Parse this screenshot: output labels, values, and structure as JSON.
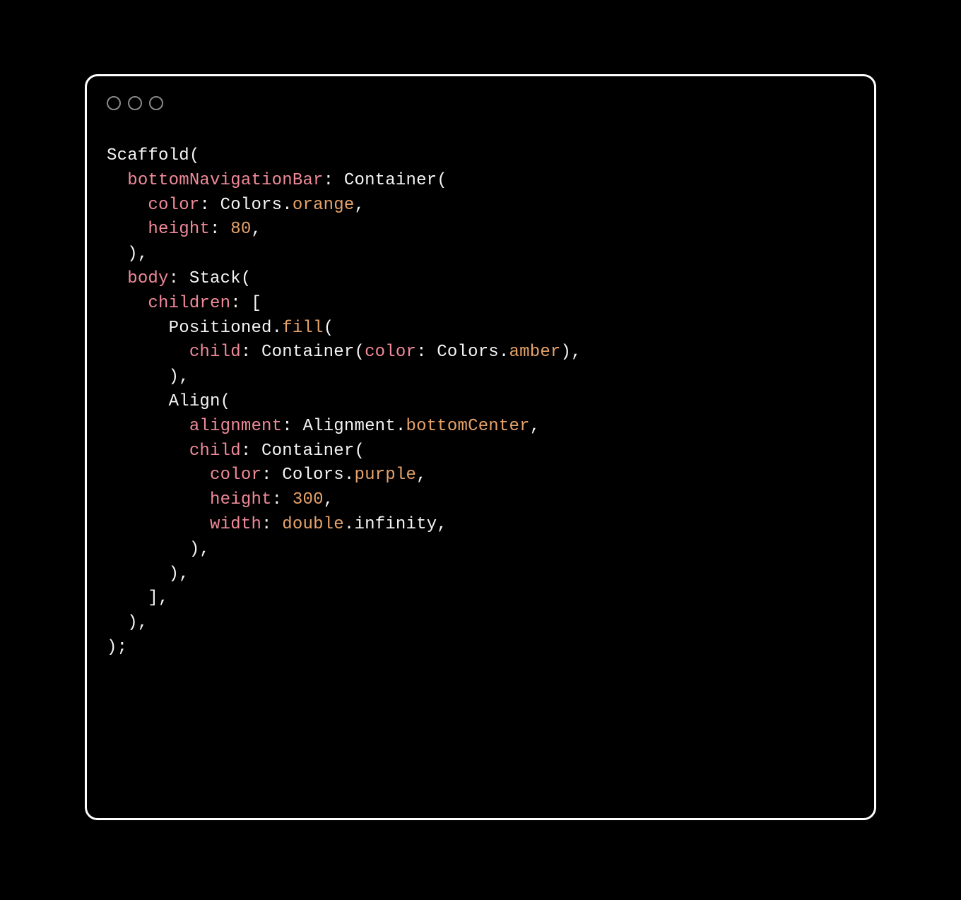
{
  "code": {
    "tokens": [
      {
        "t": "Scaffold(",
        "c": "default",
        "nl": true,
        "indent": 0
      },
      {
        "t": "bottomNavigationBar",
        "c": "pink",
        "indent": 1
      },
      {
        "t": ": Container(",
        "c": "default",
        "nl": true
      },
      {
        "t": "color",
        "c": "pink",
        "indent": 2
      },
      {
        "t": ": Colors.",
        "c": "default"
      },
      {
        "t": "orange",
        "c": "orange"
      },
      {
        "t": ",",
        "c": "default",
        "nl": true
      },
      {
        "t": "height",
        "c": "pink",
        "indent": 2
      },
      {
        "t": ": ",
        "c": "default"
      },
      {
        "t": "80",
        "c": "orange"
      },
      {
        "t": ",",
        "c": "default",
        "nl": true
      },
      {
        "t": "),",
        "c": "default",
        "indent": 1,
        "nl": true
      },
      {
        "t": "body",
        "c": "pink",
        "indent": 1
      },
      {
        "t": ": Stack(",
        "c": "default",
        "nl": true
      },
      {
        "t": "children",
        "c": "pink",
        "indent": 2
      },
      {
        "t": ": [",
        "c": "default",
        "nl": true
      },
      {
        "t": "Positioned.",
        "c": "default",
        "indent": 3
      },
      {
        "t": "fill",
        "c": "orange"
      },
      {
        "t": "(",
        "c": "default",
        "nl": true
      },
      {
        "t": "child",
        "c": "pink",
        "indent": 4
      },
      {
        "t": ": Container(",
        "c": "default"
      },
      {
        "t": "color",
        "c": "pink"
      },
      {
        "t": ": Colors.",
        "c": "default"
      },
      {
        "t": "amber",
        "c": "orange"
      },
      {
        "t": "),",
        "c": "default",
        "nl": true
      },
      {
        "t": "),",
        "c": "default",
        "indent": 3,
        "nl": true
      },
      {
        "t": "Align(",
        "c": "default",
        "indent": 3,
        "nl": true
      },
      {
        "t": "alignment",
        "c": "pink",
        "indent": 4
      },
      {
        "t": ": Alignment.",
        "c": "default"
      },
      {
        "t": "bottomCenter",
        "c": "orange"
      },
      {
        "t": ",",
        "c": "default",
        "nl": true
      },
      {
        "t": "child",
        "c": "pink",
        "indent": 4
      },
      {
        "t": ": Container(",
        "c": "default",
        "nl": true
      },
      {
        "t": "color",
        "c": "pink",
        "indent": 5
      },
      {
        "t": ": Colors.",
        "c": "default"
      },
      {
        "t": "purple",
        "c": "orange"
      },
      {
        "t": ",",
        "c": "default",
        "nl": true
      },
      {
        "t": "height",
        "c": "pink",
        "indent": 5
      },
      {
        "t": ": ",
        "c": "default"
      },
      {
        "t": "300",
        "c": "orange"
      },
      {
        "t": ",",
        "c": "default",
        "nl": true
      },
      {
        "t": "width",
        "c": "pink",
        "indent": 5
      },
      {
        "t": ": ",
        "c": "default"
      },
      {
        "t": "double",
        "c": "orange"
      },
      {
        "t": ".infinity,",
        "c": "default",
        "nl": true
      },
      {
        "t": "),",
        "c": "default",
        "indent": 4,
        "nl": true
      },
      {
        "t": "),",
        "c": "default",
        "indent": 3,
        "nl": true
      },
      {
        "t": "],",
        "c": "default",
        "indent": 2,
        "nl": true
      },
      {
        "t": "),",
        "c": "default",
        "indent": 1,
        "nl": true
      },
      {
        "t": ");",
        "c": "default",
        "indent": 0,
        "nl": false
      }
    ],
    "indent_unit": "  "
  }
}
